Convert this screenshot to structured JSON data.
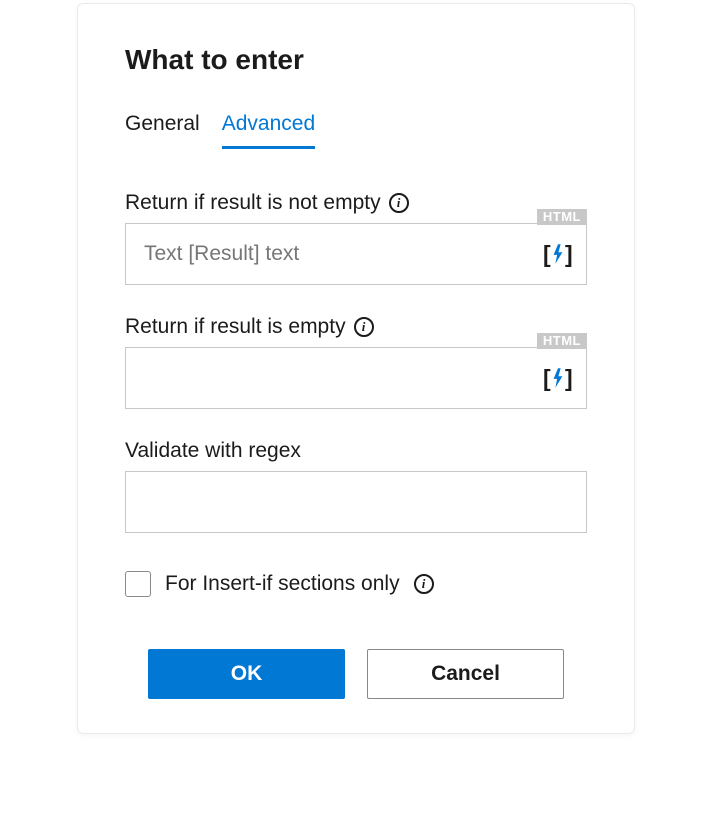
{
  "dialog": {
    "title": "What to enter"
  },
  "tabs": {
    "general": {
      "label": "General",
      "active": false
    },
    "advanced": {
      "label": "Advanced",
      "active": true
    }
  },
  "fields": {
    "return_not_empty": {
      "label": "Return if result is not empty",
      "placeholder": "Text [Result] text",
      "value": "",
      "badge": "HTML"
    },
    "return_empty": {
      "label": "Return if result is empty",
      "placeholder": "",
      "value": "",
      "badge": "HTML"
    },
    "validate_regex": {
      "label": "Validate with regex",
      "value": ""
    }
  },
  "checkbox": {
    "insert_if": {
      "label": "For Insert-if sections only",
      "checked": false
    }
  },
  "buttons": {
    "ok": "OK",
    "cancel": "Cancel"
  }
}
